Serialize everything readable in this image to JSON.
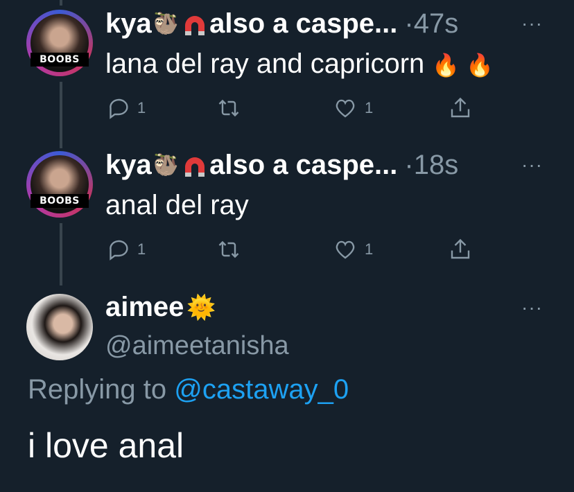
{
  "tweets": [
    {
      "name": "kya",
      "name_suffix": "also a caspe...",
      "time": "·47s",
      "text": "lana del ray and capricorn",
      "text_emoji": "🔥 🔥",
      "badge": "BOOBS",
      "replies": "1",
      "likes": "1"
    },
    {
      "name": "kya",
      "name_suffix": "also a caspe...",
      "time": "·18s",
      "text": "anal del ray",
      "badge": "BOOBS",
      "replies": "1",
      "likes": "1"
    }
  ],
  "main_tweet": {
    "display_name": "aimee",
    "handle": "@aimeetanisha",
    "replying_prefix": "Replying to",
    "replying_handle": "@castaway_0",
    "text": "i love anal"
  },
  "more_label": "···",
  "icons": {
    "sloth": "🦥",
    "magnet": "magnet-icon",
    "sun": "🌞"
  }
}
